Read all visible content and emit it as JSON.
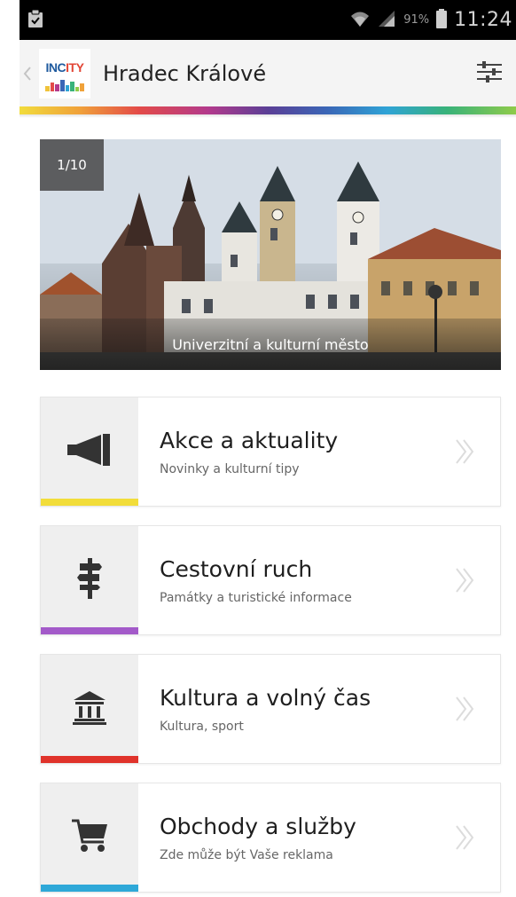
{
  "status_bar": {
    "battery_pct": "91%",
    "time": "11:24"
  },
  "app_bar": {
    "logo_text_1": "INC",
    "logo_text_2": "ITY",
    "title": "Hradec Králové"
  },
  "hero": {
    "counter": "1/10",
    "caption": "Univerzitní a kulturní město"
  },
  "menu": [
    {
      "title": "Akce a aktuality",
      "subtitle": "Novinky a kulturní tipy",
      "accent": "#f2dd3a",
      "icon": "megaphone-icon"
    },
    {
      "title": "Cestovní ruch",
      "subtitle": "Památky a turistické informace",
      "accent": "#a35ac9",
      "icon": "signpost-icon"
    },
    {
      "title": "Kultura a volný čas",
      "subtitle": "Kultura, sport",
      "accent": "#e0332b",
      "icon": "museum-icon"
    },
    {
      "title": "Obchody a služby",
      "subtitle": "Zde může být Vaše reklama",
      "accent": "#2ea8d8",
      "icon": "cart-icon"
    }
  ]
}
